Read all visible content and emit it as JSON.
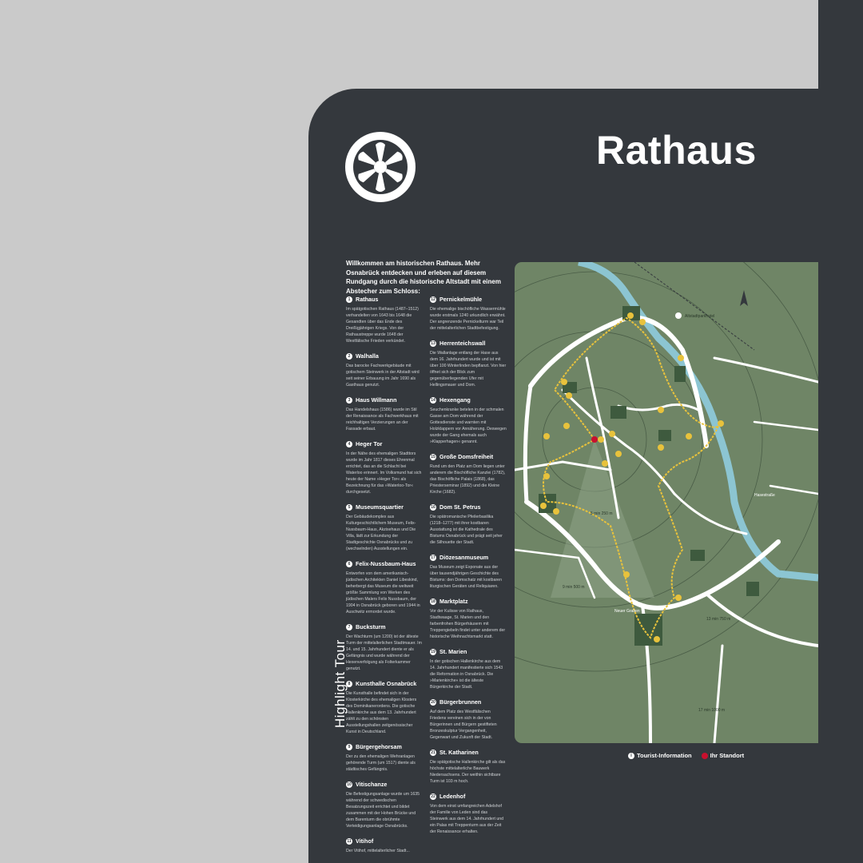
{
  "header": {
    "title": "Rathaus"
  },
  "intro": "Willkommen am historischen Rathaus. Mehr Osnabrück entdecken und erleben auf diesem Rundgang durch die historische Altstadt mit einem Abstecher zum Schloss:",
  "stops_left": [
    {
      "num": "1",
      "name": "Rathaus",
      "text": "Im spätgotischen Rathaus (1487–1512) verhandelten von 1643 bis 1648 die Gesandten über das Ende des Dreißigjährigen Kriegs. Von der Rathaustreppe wurde 1648 der Westfälische Frieden verkündet."
    },
    {
      "num": "2",
      "name": "Walhalla",
      "text": "Das barocke Fachwerkgebäude mit gotischem Steinwerk in der Altstadt wird seit seiner Erbauung im Jahr 1690 als Gasthaus genutzt."
    },
    {
      "num": "3",
      "name": "Haus Willmann",
      "text": "Das Handelshaus (1586) wurde im Stil der Renaissance als Fachwerkhaus mit reichhaltigen Verzierungen an der Fassade erbaut."
    },
    {
      "num": "4",
      "name": "Heger Tor",
      "text": "In der Nähe des ehemaligen Stadttors wurde im Jahr 1817 dieses Ehrenmal errichtet, das an die Schlacht bei Waterloo erinnert. Im Volksmund hat sich heute der Name »Heger Tor« als Bezeichnung für das »Waterloo-Tor« durchgesetzt."
    },
    {
      "num": "5",
      "name": "Museumsquartier",
      "text": "Der Gebäudekomplex aus Kulturgeschichtlichem Museum, Felix-Nussbaum-Haus, Akzisehaus und Die Villa, lädt zur Erkundung der Stadtgeschichte Osnabrücks und zu (wechselnden) Ausstellungen ein."
    },
    {
      "num": "6",
      "name": "Felix-Nussbaum-Haus",
      "text": "Entworfen von dem amerikanisch-jüdischen Architekten Daniel Libeskind, beherbergt das Museum die weltweit größte Sammlung von Werken des jüdischen Malers Felix Nussbaum, der 1904 in Osnabrück geboren und 1944 in Auschwitz ermordet wurde."
    },
    {
      "num": "7",
      "name": "Bucksturm",
      "text": "Der Wachturm (um 1200) ist der älteste Turm der mittelalterlichen Stadtmauer. Im 14. und 15. Jahrhundert diente er als Gefängnis und wurde während der Hexenverfolgung als Folterkammer genutzt."
    },
    {
      "num": "8",
      "name": "Kunsthalle Osnabrück",
      "text": "Die Kunsthalle befindet sich in der Klosterkirche des ehemaligen Klosters des Dominikanerordens. Die gotische Hallenkirche aus dem 13. Jahrhundert zählt zu den schönsten Ausstellungshallen zeitgenössischer Kunst in Deutschland."
    },
    {
      "num": "9",
      "name": "Bürgergehorsam",
      "text": "Der zu den ehemaligen Wehranlagen gehörende Turm (um 1517) diente als städtisches Gefängnis."
    },
    {
      "num": "10",
      "name": "Vitischanze",
      "text": "Die Befestigungsanlage wurde um 1635 während der schwedischen Besatzungszeit errichtet und bildet zusammen mit der Hohen Brücke und dem Barenturm die obrühmte Verteidigungsanlage Osnabrücks."
    },
    {
      "num": "11",
      "name": "Vitihof",
      "text": "Der Vitihof, mittelalterlicher Stadt..."
    }
  ],
  "stops_right": [
    {
      "num": "12",
      "name": "Pernickelmühle",
      "text": "Die ehemalige bischöfliche Wassermühle wurde erstmals 1240 urkundlich erwähnt. Der angrenzende Pernickelturm war Teil der mittelalterlichen Stadtbefestigung."
    },
    {
      "num": "13",
      "name": "Herrenteichswall",
      "text": "Die Wallanlage entlang der Hase aus dem 16. Jahrhundert wurde und ist mit über 100 Winterlinden bepflanzt. Von hier öffnet sich der Blick zum gegenüberliegenden Ufer mit Hellingsmauer und Dom."
    },
    {
      "num": "14",
      "name": "Hexengang",
      "text": "Seuchenkranke betelen in der schmalen Gasse am Dom während der Gottesdienste und warnten mit Holzklappern vor Annäherung. Deswegen wurde der Gang ehemals auch »Klapperhagen« genannt."
    },
    {
      "num": "15",
      "name": "Große Domsfreiheit",
      "text": "Rund um den Platz am Dom liegen unter anderem die Bischöfliche Kanzlei (1782), das Bischöfliche Palais (1868), das Priesterseminar (1892) und die Kleine Kirche (1682)."
    },
    {
      "num": "16",
      "name": "Dom St. Petrus",
      "text": "Die spätromanische Pfeilerbasilika (1218–1277) mit ihrer kostbaren Ausstattung ist die Kathedrale des Bistums Osnabrück und prägt seit jeher die Silhouette der Stadt."
    },
    {
      "num": "17",
      "name": "Diözesanmuseum",
      "text": "Das Museum zeigt Exponate aus der über tausendjährigen Geschichte des Bistums: den Domschatz mit kostbaren liturgischen Geräten und Reliquiaren."
    },
    {
      "num": "18",
      "name": "Marktplatz",
      "text": "Vor der Kulisse von Rathaus, Stadtwaage, St. Marien und den farbenfrohen Bürgerhäusern mit Treppengiebeln findet unter anderem der historische Weihnachtsmarkt statt."
    },
    {
      "num": "19",
      "name": "St. Marien",
      "text": "In der gotischen Hallenkirche aus dem 14. Jahrhundert manifestierte sich 1543 die Reformation in Osnabrück. Die »Marienkirche« ist die älteste Bürgerkirche der Stadt."
    },
    {
      "num": "20",
      "name": "Bürgerbrunnen",
      "text": "Auf dem Platz des Westfälischen Friedens vereinen sich in der von Bürgerinnen und Bürgern gestifteten Bronzeskulptur Vergangenheit, Gegenwart und Zukunft der Stadt."
    },
    {
      "num": "21",
      "name": "St. Katharinen",
      "text": "Die spätgotische Hallenkirche gilt als das höchste mittelalterliche Bauwerk Niedersachsens. Der weithin sichtbare Turm ist 103 m hoch."
    },
    {
      "num": "22",
      "name": "Ledenhof",
      "text": "Von dem einst umfangreichen Adelshof der Familie von Leden sind das Steinwerk aus dem 14. Jahrhundert und ein Palas mit Treppenturm aus der Zeit der Renaissance erhalten."
    }
  ],
  "map": {
    "side_label": "Highlight Tour",
    "labels": {
      "parking": "Altstadtparkhotel",
      "d250": "5 min 250 m",
      "d500": "9 min 500 m",
      "d750": "13 min 750 m",
      "d1000": "17 min 1000 m",
      "street_graben": "Neuer Graben",
      "street_hase": "Hasestraße"
    },
    "colors": {
      "land": "#6f8566",
      "water": "#8cc5d2",
      "route": "#e8c23c",
      "buildings": "#3e5a3e"
    }
  },
  "legend": {
    "info_icon": "i",
    "info_label": "Tourist-Information",
    "here_label": "Ihr Standort"
  }
}
